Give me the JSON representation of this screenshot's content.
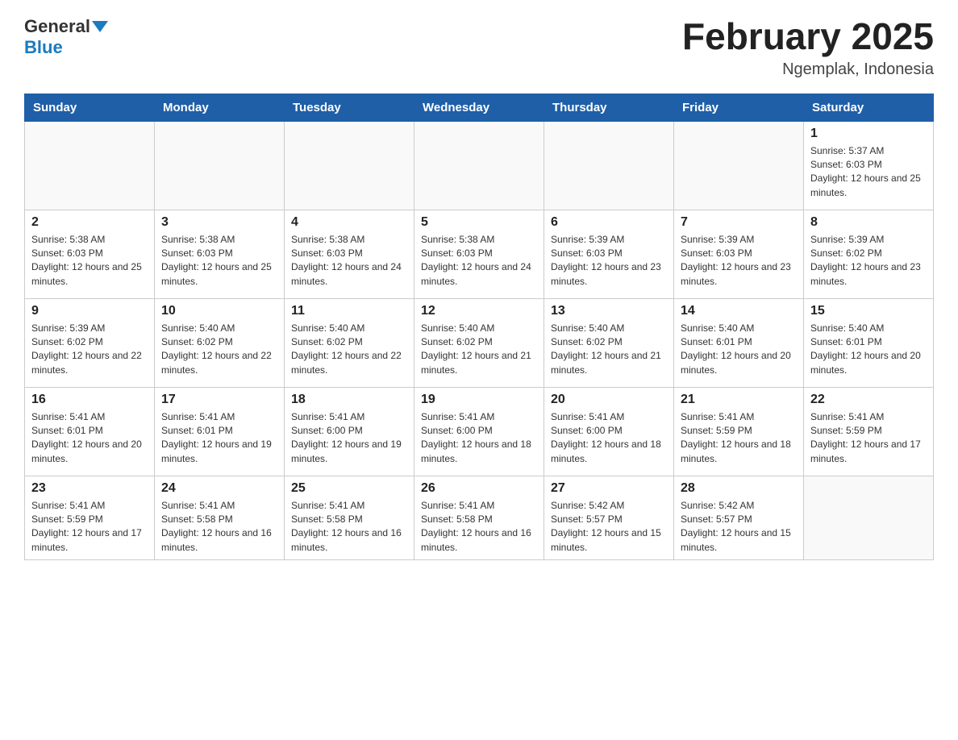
{
  "header": {
    "logo_general": "General",
    "logo_blue": "Blue",
    "month_title": "February 2025",
    "location": "Ngemplak, Indonesia"
  },
  "days_of_week": [
    "Sunday",
    "Monday",
    "Tuesday",
    "Wednesday",
    "Thursday",
    "Friday",
    "Saturday"
  ],
  "weeks": [
    [
      {
        "day": "",
        "info": ""
      },
      {
        "day": "",
        "info": ""
      },
      {
        "day": "",
        "info": ""
      },
      {
        "day": "",
        "info": ""
      },
      {
        "day": "",
        "info": ""
      },
      {
        "day": "",
        "info": ""
      },
      {
        "day": "1",
        "info": "Sunrise: 5:37 AM\nSunset: 6:03 PM\nDaylight: 12 hours and 25 minutes."
      }
    ],
    [
      {
        "day": "2",
        "info": "Sunrise: 5:38 AM\nSunset: 6:03 PM\nDaylight: 12 hours and 25 minutes."
      },
      {
        "day": "3",
        "info": "Sunrise: 5:38 AM\nSunset: 6:03 PM\nDaylight: 12 hours and 25 minutes."
      },
      {
        "day": "4",
        "info": "Sunrise: 5:38 AM\nSunset: 6:03 PM\nDaylight: 12 hours and 24 minutes."
      },
      {
        "day": "5",
        "info": "Sunrise: 5:38 AM\nSunset: 6:03 PM\nDaylight: 12 hours and 24 minutes."
      },
      {
        "day": "6",
        "info": "Sunrise: 5:39 AM\nSunset: 6:03 PM\nDaylight: 12 hours and 23 minutes."
      },
      {
        "day": "7",
        "info": "Sunrise: 5:39 AM\nSunset: 6:03 PM\nDaylight: 12 hours and 23 minutes."
      },
      {
        "day": "8",
        "info": "Sunrise: 5:39 AM\nSunset: 6:02 PM\nDaylight: 12 hours and 23 minutes."
      }
    ],
    [
      {
        "day": "9",
        "info": "Sunrise: 5:39 AM\nSunset: 6:02 PM\nDaylight: 12 hours and 22 minutes."
      },
      {
        "day": "10",
        "info": "Sunrise: 5:40 AM\nSunset: 6:02 PM\nDaylight: 12 hours and 22 minutes."
      },
      {
        "day": "11",
        "info": "Sunrise: 5:40 AM\nSunset: 6:02 PM\nDaylight: 12 hours and 22 minutes."
      },
      {
        "day": "12",
        "info": "Sunrise: 5:40 AM\nSunset: 6:02 PM\nDaylight: 12 hours and 21 minutes."
      },
      {
        "day": "13",
        "info": "Sunrise: 5:40 AM\nSunset: 6:02 PM\nDaylight: 12 hours and 21 minutes."
      },
      {
        "day": "14",
        "info": "Sunrise: 5:40 AM\nSunset: 6:01 PM\nDaylight: 12 hours and 20 minutes."
      },
      {
        "day": "15",
        "info": "Sunrise: 5:40 AM\nSunset: 6:01 PM\nDaylight: 12 hours and 20 minutes."
      }
    ],
    [
      {
        "day": "16",
        "info": "Sunrise: 5:41 AM\nSunset: 6:01 PM\nDaylight: 12 hours and 20 minutes."
      },
      {
        "day": "17",
        "info": "Sunrise: 5:41 AM\nSunset: 6:01 PM\nDaylight: 12 hours and 19 minutes."
      },
      {
        "day": "18",
        "info": "Sunrise: 5:41 AM\nSunset: 6:00 PM\nDaylight: 12 hours and 19 minutes."
      },
      {
        "day": "19",
        "info": "Sunrise: 5:41 AM\nSunset: 6:00 PM\nDaylight: 12 hours and 18 minutes."
      },
      {
        "day": "20",
        "info": "Sunrise: 5:41 AM\nSunset: 6:00 PM\nDaylight: 12 hours and 18 minutes."
      },
      {
        "day": "21",
        "info": "Sunrise: 5:41 AM\nSunset: 5:59 PM\nDaylight: 12 hours and 18 minutes."
      },
      {
        "day": "22",
        "info": "Sunrise: 5:41 AM\nSunset: 5:59 PM\nDaylight: 12 hours and 17 minutes."
      }
    ],
    [
      {
        "day": "23",
        "info": "Sunrise: 5:41 AM\nSunset: 5:59 PM\nDaylight: 12 hours and 17 minutes."
      },
      {
        "day": "24",
        "info": "Sunrise: 5:41 AM\nSunset: 5:58 PM\nDaylight: 12 hours and 16 minutes."
      },
      {
        "day": "25",
        "info": "Sunrise: 5:41 AM\nSunset: 5:58 PM\nDaylight: 12 hours and 16 minutes."
      },
      {
        "day": "26",
        "info": "Sunrise: 5:41 AM\nSunset: 5:58 PM\nDaylight: 12 hours and 16 minutes."
      },
      {
        "day": "27",
        "info": "Sunrise: 5:42 AM\nSunset: 5:57 PM\nDaylight: 12 hours and 15 minutes."
      },
      {
        "day": "28",
        "info": "Sunrise: 5:42 AM\nSunset: 5:57 PM\nDaylight: 12 hours and 15 minutes."
      },
      {
        "day": "",
        "info": ""
      }
    ]
  ]
}
